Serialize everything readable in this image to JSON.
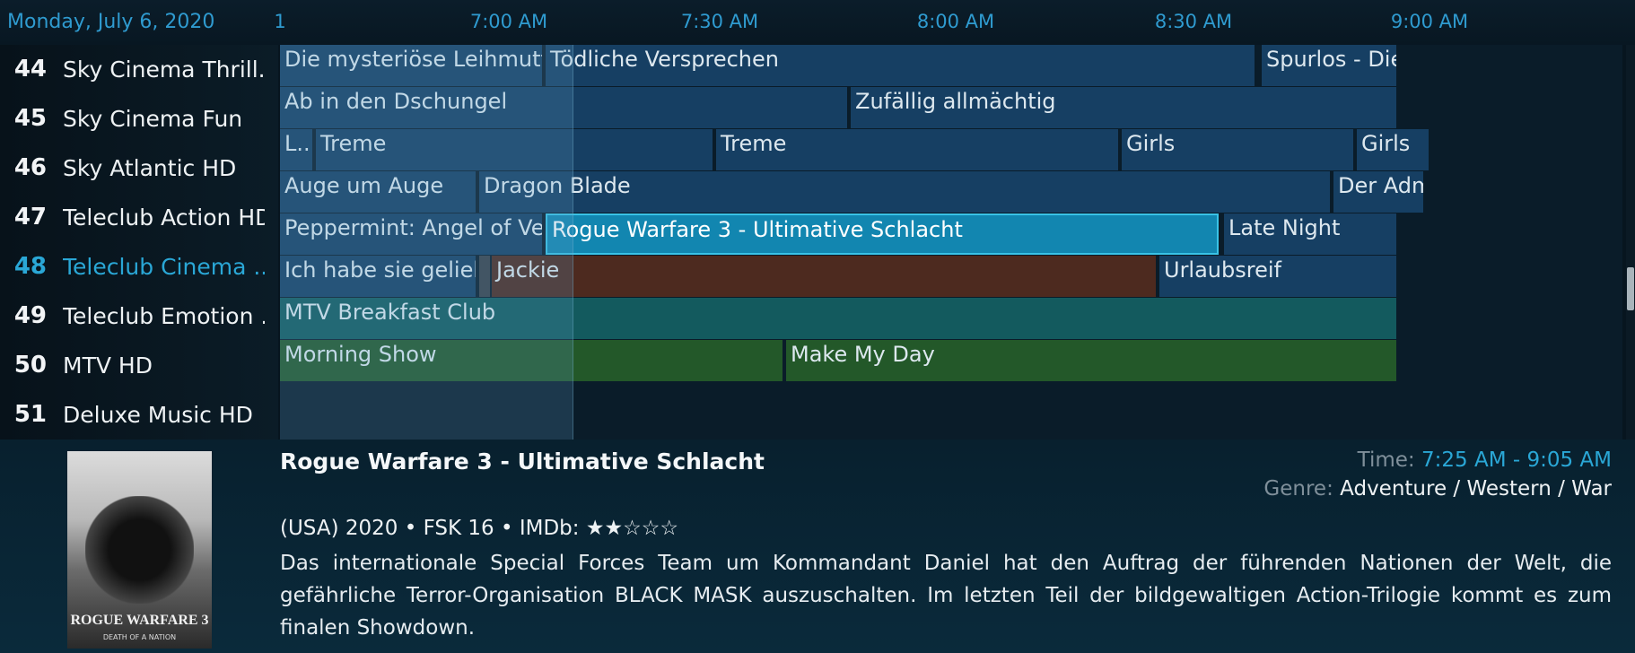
{
  "header": {
    "date": "Monday, July 6, 2020",
    "times": [
      "1",
      "7:00 AM",
      "7:30 AM",
      "8:00 AM",
      "8:30 AM",
      "9:00 AM"
    ]
  },
  "channels": [
    {
      "num": "44",
      "name": "Sky Cinema Thrill..."
    },
    {
      "num": "45",
      "name": "Sky Cinema Fun"
    },
    {
      "num": "46",
      "name": "Sky Atlantic HD"
    },
    {
      "num": "47",
      "name": "Teleclub Action HD"
    },
    {
      "num": "48",
      "name": "Teleclub Cinema ...",
      "active": true
    },
    {
      "num": "49",
      "name": "Teleclub Emotion ..."
    },
    {
      "num": "50",
      "name": "MTV HD"
    },
    {
      "num": "51",
      "name": "Deluxe Music HD"
    }
  ],
  "programs": [
    [
      {
        "title": "Die mysteriöse Leihmutter",
        "color": "#163f63"
      },
      {
        "title": "Tödliche Versprechen",
        "color": "#163f63"
      },
      {
        "title": "Spurlos - Die Entführung",
        "color": "#163f63"
      }
    ],
    [
      {
        "title": "Ab in den Dschungel",
        "color": "#163f63"
      },
      {
        "title": "Zufällig allmächtig",
        "color": "#163f63"
      }
    ],
    [
      {
        "title": "L...",
        "color": "#163f63"
      },
      {
        "title": "Treme",
        "color": "#163f63"
      },
      {
        "title": "Treme",
        "color": "#163f63"
      },
      {
        "title": "Girls",
        "color": "#163f63"
      },
      {
        "title": "Girls",
        "color": "#163f63"
      }
    ],
    [
      {
        "title": "Auge um Auge",
        "color": "#163f63"
      },
      {
        "title": "Dragon Blade",
        "color": "#163f63"
      },
      {
        "title": "Der Admiral",
        "color": "#163f63"
      }
    ],
    [
      {
        "title": "Peppermint: Angel of Vengeance",
        "color": "#163f63"
      },
      {
        "title": "Rogue Warfare 3 - Ultimative Schlacht",
        "color": "#1286b0",
        "selected": true
      },
      {
        "title": "Late Night",
        "color": "#163f63"
      }
    ],
    [
      {
        "title": "Ich habe sie geliebt",
        "color": "#163f63"
      },
      {
        "title": "",
        "color": "#3a4048"
      },
      {
        "title": "Jackie",
        "color": "#4d2a1f"
      },
      {
        "title": "Urlaubsreif",
        "color": "#163f63"
      }
    ],
    [
      {
        "title": "MTV Breakfast Club",
        "color": "#135a5e"
      }
    ],
    [
      {
        "title": "Morning Show",
        "color": "#235829"
      },
      {
        "title": "Make My Day",
        "color": "#235829"
      }
    ]
  ],
  "details": {
    "title": "Rogue Warfare 3 - Ultimative Schlacht",
    "time_label": "Time: ",
    "time_value": "7:25 AM - 9:05 AM",
    "genre_label": "Genre: ",
    "genre_value": "Adventure / Western / War",
    "meta": "(USA) 2020 • FSK 16 • IMDb: ★★☆☆☆",
    "description": "Das internationale Special Forces Team um Kommandant Daniel hat den Auftrag der führenden Nationen der Welt, die gefährliche Terror-Organisation BLACK MASK auszuschalten. Im letzten Teil der bildgewaltigen Action-Trilogie kommt es zum finalen Showdown.",
    "poster_title": "ROGUE WARFARE 3",
    "poster_subtitle": "DEATH OF A NATION"
  },
  "colors": {
    "accent": "#2aa7d6",
    "selected": "#1286b0",
    "program": "#163f63"
  }
}
